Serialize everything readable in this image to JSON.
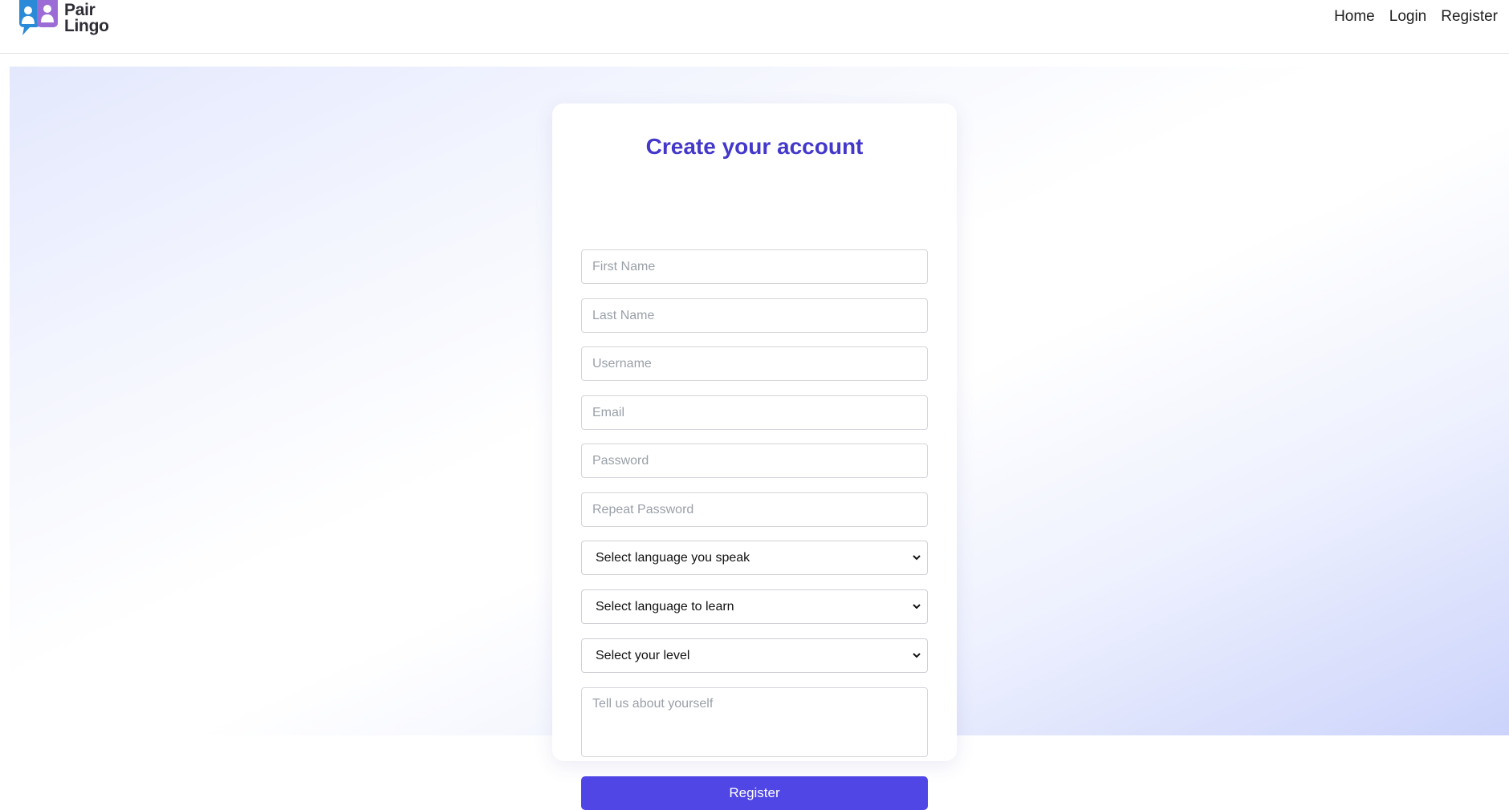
{
  "brand": {
    "line1": "Pair",
    "line2": "Lingo"
  },
  "nav": {
    "home": "Home",
    "login": "Login",
    "register": "Register"
  },
  "form": {
    "title": "Create your account",
    "first_name_placeholder": "First Name",
    "last_name_placeholder": "Last Name",
    "username_placeholder": "Username",
    "email_placeholder": "Email",
    "password_placeholder": "Password",
    "repeat_password_placeholder": "Repeat Password",
    "speak_select": "Select language you speak",
    "learn_select": "Select language to learn",
    "level_select": "Select your level",
    "about_placeholder": "Tell us about yourself",
    "submit_label": "Register"
  },
  "colors": {
    "accent": "#4f46e5",
    "title": "#4338ca",
    "logo_blue": "#2b8ad8",
    "logo_purple": "#9b6bd6"
  },
  "icons": {
    "logo": "chat-people-logo-icon",
    "select_arrow": "chevron-down-icon"
  }
}
